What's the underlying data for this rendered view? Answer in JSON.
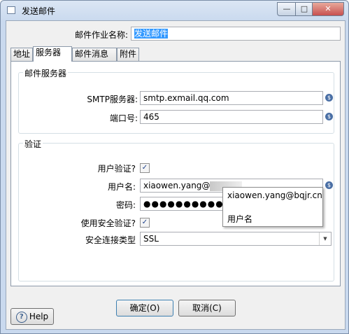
{
  "window": {
    "title": "发送邮件",
    "minimize_glyph": "—",
    "maximize_glyph": "□",
    "close_glyph": "✕"
  },
  "job_name": {
    "label": "邮件作业名称:",
    "value": "发送邮件"
  },
  "tabs": [
    {
      "label": "地址",
      "active": false
    },
    {
      "label": "服务器",
      "active": true
    },
    {
      "label": "邮件消息",
      "active": false
    },
    {
      "label": "附件",
      "active": false
    }
  ],
  "mail_server": {
    "group_title": "邮件服务器",
    "smtp_label": "SMTP服务器:",
    "smtp_value": "smtp.exmail.qq.com",
    "port_label": "端口号:",
    "port_value": "465"
  },
  "auth": {
    "group_title": "验证",
    "user_auth_label": "用户验证?",
    "user_auth_checked": true,
    "username_label": "用户名:",
    "username_value": "xiaowen.yang@",
    "password_label": "密码:",
    "password_value": "●●●●●●●●●●",
    "secure_auth_label": "使用安全验证?",
    "secure_auth_checked": true,
    "conn_type_label": "安全连接类型",
    "conn_type_value": "SSL"
  },
  "tooltip": {
    "line1": "xiaowen.yang@bqjr.cn",
    "line2": "用户名"
  },
  "buttons": {
    "ok": "确定(O)",
    "cancel": "取消(C)",
    "help": "Help"
  },
  "icons": {
    "variable": "$",
    "check": "✓",
    "dropdown": "▼",
    "help": "?"
  },
  "colors": {
    "selection": "#3399ff",
    "accent": "#4a6fa5"
  }
}
